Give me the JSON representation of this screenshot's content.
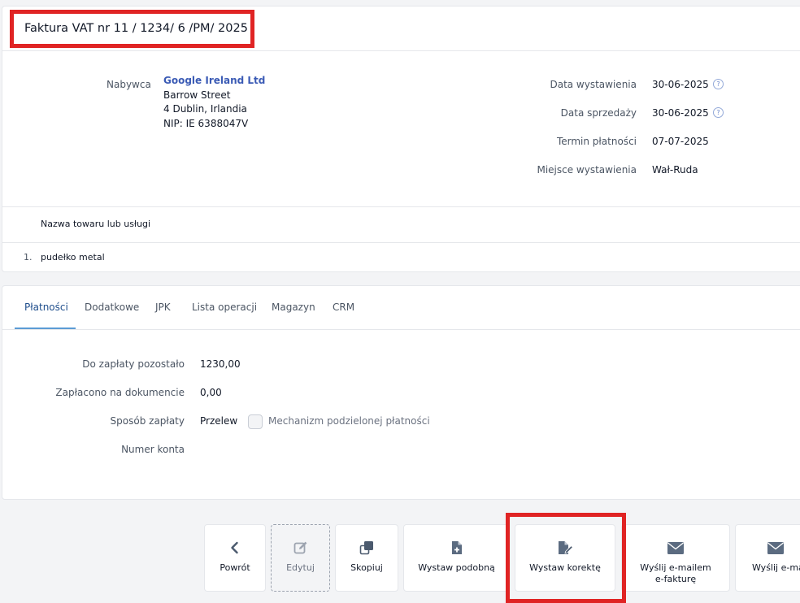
{
  "invoice": {
    "title": "Faktura VAT nr 11 / 1234/ 6 /PM/ 2025"
  },
  "buyer": {
    "label": "Nabywca",
    "name": "Google Ireland Ltd",
    "street": "Barrow Street",
    "city": "4 Dublin, Irlandia",
    "nip": "NIP: IE 6388047V"
  },
  "dates": [
    {
      "label": "Data wystawienia",
      "value": "30-06-2025",
      "help": "?"
    },
    {
      "label": "Data sprzedaży",
      "value": "30-06-2025",
      "help": "?"
    },
    {
      "label": "Termin płatności",
      "value": "07-07-2025"
    },
    {
      "label": "Miejsce wystawienia",
      "value": "Wał-Ruda"
    }
  ],
  "items_table": {
    "header": "Nazwa towaru lub usługi",
    "rows": [
      {
        "number": "1.",
        "name": "pudełko metal"
      }
    ]
  },
  "tabs": [
    "Płatności",
    "Dodatkowe",
    "JPK",
    "Lista operacji",
    "Magazyn",
    "CRM"
  ],
  "payment": {
    "remaining_label": "Do zapłaty pozostało",
    "remaining_value": "1230,00",
    "paid_label": "Zapłacono na dokumencie",
    "paid_value": "0,00",
    "method_label": "Sposób zapłaty",
    "method_value": "Przelew",
    "split_payment_label": "Mechanizm podzielonej płatności",
    "split_payment_checked": false,
    "account_label": "Numer konta"
  },
  "actions": {
    "back": {
      "label": "Powrót",
      "icon": "chevron-left-icon"
    },
    "edit": {
      "label": "Edytuj",
      "icon": "pencil-square-icon"
    },
    "copy": {
      "label": "Skopiuj",
      "icon": "copy-icon"
    },
    "similar": {
      "label": "Wystaw podobną",
      "icon": "file-plus-icon"
    },
    "correction": {
      "label": "Wystaw korektę",
      "icon": "file-pen-icon"
    },
    "email_einvoice": {
      "label_line1": "Wyślij e-mailem",
      "label_line2": "e-fakturę",
      "icon": "envelope-icon"
    },
    "email": {
      "label": "Wyślij e-ma",
      "icon": "envelope-icon"
    }
  },
  "colors": {
    "highlight": "#e02424",
    "link": "#3b5bb5",
    "active_tab": "#1f4e8c",
    "tab_underline": "#5b9bd5",
    "icon": "#4b5a6e"
  }
}
